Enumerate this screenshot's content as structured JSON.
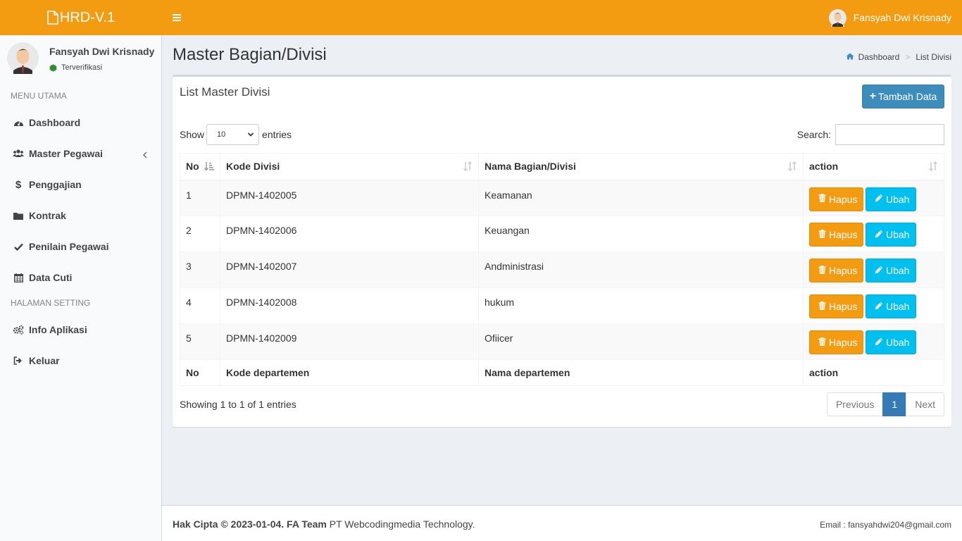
{
  "app": {
    "title": "HRD-V.1"
  },
  "header": {
    "user_name": "Fansyah Dwi Krisnady"
  },
  "sidebar": {
    "user_name": "Fansyah Dwi Krisnady",
    "status": "Terverifikasi",
    "section_main": "MENU UTAMA",
    "section_setting": "HALAMAN SETTING",
    "items": [
      {
        "label": "Dashboard",
        "icon": "dashboard-icon"
      },
      {
        "label": "Master Pegawai",
        "icon": "users-icon"
      },
      {
        "label": "Penggajian",
        "icon": "dollar-icon"
      },
      {
        "label": "Kontrak",
        "icon": "folder-icon"
      },
      {
        "label": "Penilain Pegawai",
        "icon": "check-icon"
      },
      {
        "label": "Data Cuti",
        "icon": "calendar-icon"
      }
    ],
    "setting_items": [
      {
        "label": "Info Aplikasi",
        "icon": "cogs-icon"
      },
      {
        "label": "Keluar",
        "icon": "sign-out-icon"
      }
    ]
  },
  "page": {
    "title": "Master Bagian/Divisi",
    "breadcrumb": {
      "home": "Dashboard",
      "current": "List Divisi"
    }
  },
  "box": {
    "title": "List Master Divisi",
    "add_button": "Tambah Data",
    "show_label": "Show",
    "entries_label": "entries",
    "page_length": "10",
    "search_label": "Search:"
  },
  "table": {
    "headers": [
      "No",
      "Kode Divisi",
      "Nama Bagian/Divisi",
      "action"
    ],
    "footers": [
      "No",
      "Kode departemen",
      "Nama departemen",
      "action"
    ],
    "rows": [
      {
        "no": "1",
        "kode": "DPMN-1402005",
        "nama": "Keamanan"
      },
      {
        "no": "2",
        "kode": "DPMN-1402006",
        "nama": "Keuangan"
      },
      {
        "no": "3",
        "kode": "DPMN-1402007",
        "nama": "Andministrasi"
      },
      {
        "no": "4",
        "kode": "DPMN-1402008",
        "nama": "hukum"
      },
      {
        "no": "5",
        "kode": "DPMN-1402009",
        "nama": "Ofiicer"
      }
    ],
    "delete_label": "Hapus",
    "edit_label": "Ubah"
  },
  "pagination": {
    "info": "Showing 1 to 1 of 1 entries",
    "previous": "Previous",
    "current": "1",
    "next": "Next"
  },
  "footer": {
    "copyright_bold": "Hak Cipta © 2023-01-04. FA Team",
    "company": " PT Webcodingmedia Technology.",
    "email": "Email : fansyahdwi204@gmail.com"
  },
  "colors": {
    "header": "#f39c12",
    "primary": "#3c8dbc",
    "warning": "#f39c12",
    "info": "#00c0ef",
    "verified": "#2e8b2e"
  }
}
